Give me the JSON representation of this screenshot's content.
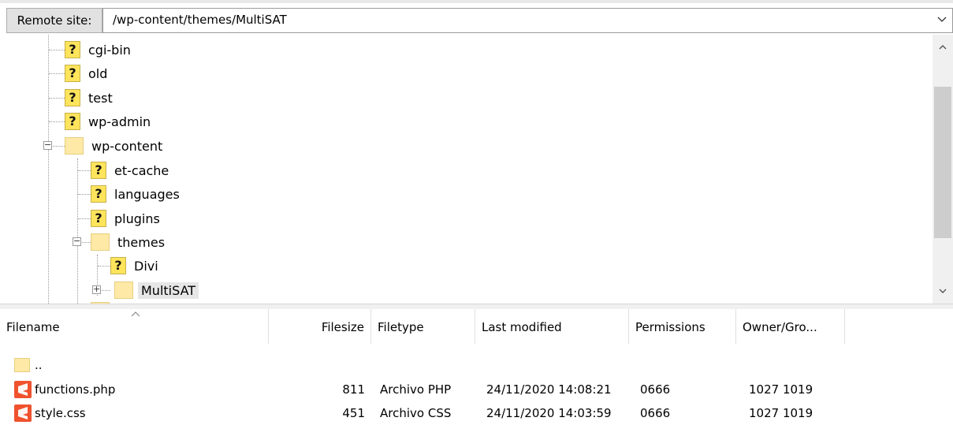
{
  "address_bar": {
    "label": "Remote site:",
    "path": "/wp-content/themes/MultiSAT"
  },
  "tree": {
    "items": [
      {
        "label": "cgi-bin",
        "icon": "unknown-folder-icon"
      },
      {
        "label": "old",
        "icon": "unknown-folder-icon"
      },
      {
        "label": "test",
        "icon": "unknown-folder-icon"
      },
      {
        "label": "wp-admin",
        "icon": "unknown-folder-icon"
      },
      {
        "label": "wp-content",
        "icon": "folder-icon",
        "expanded": true
      },
      {
        "label": "et-cache",
        "icon": "unknown-folder-icon"
      },
      {
        "label": "languages",
        "icon": "unknown-folder-icon"
      },
      {
        "label": "plugins",
        "icon": "unknown-folder-icon"
      },
      {
        "label": "themes",
        "icon": "folder-icon",
        "expanded": true
      },
      {
        "label": "Divi",
        "icon": "unknown-folder-icon"
      },
      {
        "label": "MultiSAT",
        "icon": "folder-icon",
        "selected": true,
        "collapsed": true
      }
    ]
  },
  "file_list": {
    "columns": [
      "Filename",
      "Filesize",
      "Filetype",
      "Last modified",
      "Permissions",
      "Owner/Gro..."
    ],
    "rows": [
      {
        "name": "..",
        "size": "",
        "type": "",
        "modified": "",
        "perms": "",
        "owner": "",
        "icon": "parent-folder-icon"
      },
      {
        "name": "functions.php",
        "size": "811",
        "type": "Archivo PHP",
        "modified": "24/11/2020 14:08:21",
        "perms": "0666",
        "owner": "1027 1019",
        "icon": "sublime-file-icon"
      },
      {
        "name": "style.css",
        "size": "451",
        "type": "Archivo CSS",
        "modified": "24/11/2020 14:03:59",
        "perms": "0666",
        "owner": "1027 1019",
        "icon": "sublime-file-icon"
      }
    ]
  },
  "colors": {
    "file_icon": "#f0522e",
    "folder": "#ffe9a6",
    "unknown_folder": "#ffe45c"
  }
}
